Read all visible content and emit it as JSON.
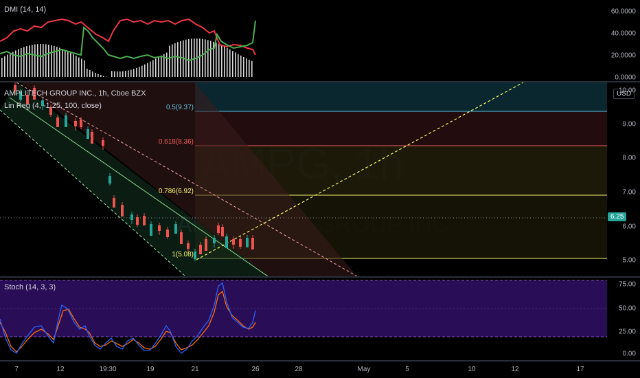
{
  "dmi": {
    "label": "DMI (14, 14)",
    "axis": [
      "60.0000",
      "40.0000",
      "20.0000",
      "0.0000"
    ]
  },
  "main": {
    "title": "AMPLITECH GROUP INC., 1h, Cboe BZX",
    "study": "Lin Reg (4, -1.25, 100, close)",
    "watermark_symbol": "AMPG, 1h",
    "watermark_name": "AMPLITECH GROUP INC.",
    "currency": "USD",
    "price_tag": "6.25",
    "axis": [
      "10.00",
      "9.00",
      "8.00",
      "7.00",
      "6.00",
      "5.00"
    ],
    "fib": [
      {
        "label": "0.5(9.37)",
        "color": "#5fc3e4"
      },
      {
        "label": "0.618(8.36)",
        "color": "#f25c5c"
      },
      {
        "label": "0.786(6.92)",
        "color": "#f5f570"
      },
      {
        "label": "1(5.08)",
        "color": "#f5f570"
      }
    ]
  },
  "stoch": {
    "label": "Stoch (14, 3, 3)",
    "axis": [
      "75.00",
      "50.00",
      "25.00",
      "0.00"
    ]
  },
  "xaxis": [
    "7",
    "12",
    "19:30",
    "19",
    "21",
    "26",
    "28",
    "May",
    "5",
    "10",
    "12",
    "17"
  ],
  "colors": {
    "up": "#26a69a",
    "down": "#ef5350",
    "fib_yellow": "#f5f570",
    "fib_red": "#f25c5c",
    "fib_blue": "#5fc3e4",
    "stoch_bg": "#2a0d57"
  }
}
